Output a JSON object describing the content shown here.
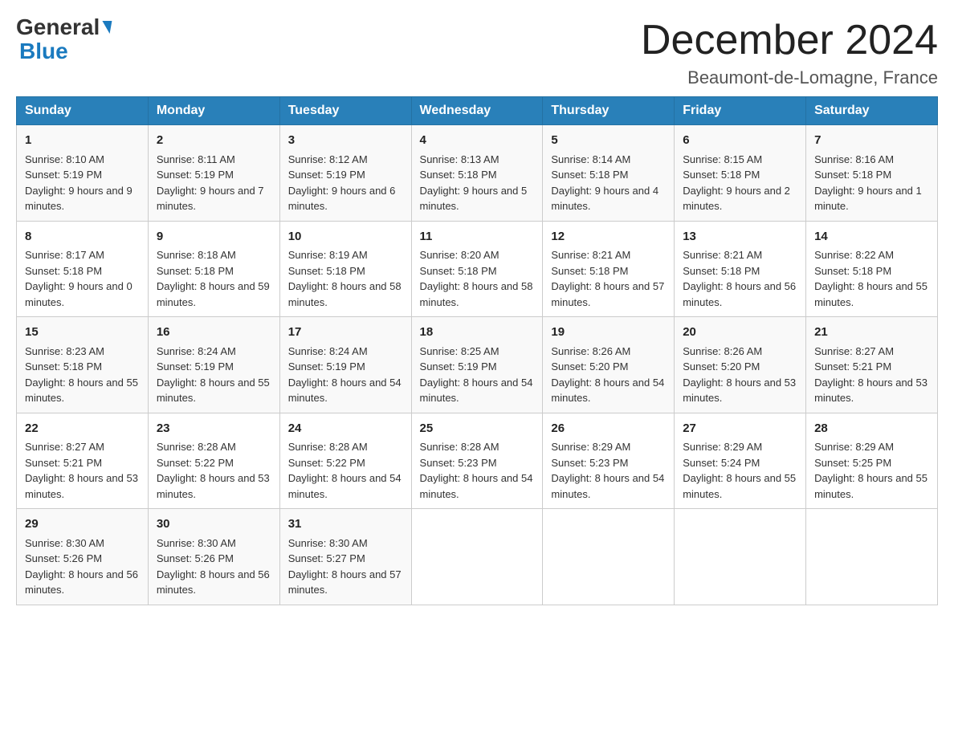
{
  "header": {
    "logo_line1": "General",
    "logo_line2": "Blue",
    "month_title": "December 2024",
    "location": "Beaumont-de-Lomagne, France"
  },
  "days_of_week": [
    "Sunday",
    "Monday",
    "Tuesday",
    "Wednesday",
    "Thursday",
    "Friday",
    "Saturday"
  ],
  "weeks": [
    [
      {
        "day": "1",
        "sunrise": "Sunrise: 8:10 AM",
        "sunset": "Sunset: 5:19 PM",
        "daylight": "Daylight: 9 hours and 9 minutes."
      },
      {
        "day": "2",
        "sunrise": "Sunrise: 8:11 AM",
        "sunset": "Sunset: 5:19 PM",
        "daylight": "Daylight: 9 hours and 7 minutes."
      },
      {
        "day": "3",
        "sunrise": "Sunrise: 8:12 AM",
        "sunset": "Sunset: 5:19 PM",
        "daylight": "Daylight: 9 hours and 6 minutes."
      },
      {
        "day": "4",
        "sunrise": "Sunrise: 8:13 AM",
        "sunset": "Sunset: 5:18 PM",
        "daylight": "Daylight: 9 hours and 5 minutes."
      },
      {
        "day": "5",
        "sunrise": "Sunrise: 8:14 AM",
        "sunset": "Sunset: 5:18 PM",
        "daylight": "Daylight: 9 hours and 4 minutes."
      },
      {
        "day": "6",
        "sunrise": "Sunrise: 8:15 AM",
        "sunset": "Sunset: 5:18 PM",
        "daylight": "Daylight: 9 hours and 2 minutes."
      },
      {
        "day": "7",
        "sunrise": "Sunrise: 8:16 AM",
        "sunset": "Sunset: 5:18 PM",
        "daylight": "Daylight: 9 hours and 1 minute."
      }
    ],
    [
      {
        "day": "8",
        "sunrise": "Sunrise: 8:17 AM",
        "sunset": "Sunset: 5:18 PM",
        "daylight": "Daylight: 9 hours and 0 minutes."
      },
      {
        "day": "9",
        "sunrise": "Sunrise: 8:18 AM",
        "sunset": "Sunset: 5:18 PM",
        "daylight": "Daylight: 8 hours and 59 minutes."
      },
      {
        "day": "10",
        "sunrise": "Sunrise: 8:19 AM",
        "sunset": "Sunset: 5:18 PM",
        "daylight": "Daylight: 8 hours and 58 minutes."
      },
      {
        "day": "11",
        "sunrise": "Sunrise: 8:20 AM",
        "sunset": "Sunset: 5:18 PM",
        "daylight": "Daylight: 8 hours and 58 minutes."
      },
      {
        "day": "12",
        "sunrise": "Sunrise: 8:21 AM",
        "sunset": "Sunset: 5:18 PM",
        "daylight": "Daylight: 8 hours and 57 minutes."
      },
      {
        "day": "13",
        "sunrise": "Sunrise: 8:21 AM",
        "sunset": "Sunset: 5:18 PM",
        "daylight": "Daylight: 8 hours and 56 minutes."
      },
      {
        "day": "14",
        "sunrise": "Sunrise: 8:22 AM",
        "sunset": "Sunset: 5:18 PM",
        "daylight": "Daylight: 8 hours and 55 minutes."
      }
    ],
    [
      {
        "day": "15",
        "sunrise": "Sunrise: 8:23 AM",
        "sunset": "Sunset: 5:18 PM",
        "daylight": "Daylight: 8 hours and 55 minutes."
      },
      {
        "day": "16",
        "sunrise": "Sunrise: 8:24 AM",
        "sunset": "Sunset: 5:19 PM",
        "daylight": "Daylight: 8 hours and 55 minutes."
      },
      {
        "day": "17",
        "sunrise": "Sunrise: 8:24 AM",
        "sunset": "Sunset: 5:19 PM",
        "daylight": "Daylight: 8 hours and 54 minutes."
      },
      {
        "day": "18",
        "sunrise": "Sunrise: 8:25 AM",
        "sunset": "Sunset: 5:19 PM",
        "daylight": "Daylight: 8 hours and 54 minutes."
      },
      {
        "day": "19",
        "sunrise": "Sunrise: 8:26 AM",
        "sunset": "Sunset: 5:20 PM",
        "daylight": "Daylight: 8 hours and 54 minutes."
      },
      {
        "day": "20",
        "sunrise": "Sunrise: 8:26 AM",
        "sunset": "Sunset: 5:20 PM",
        "daylight": "Daylight: 8 hours and 53 minutes."
      },
      {
        "day": "21",
        "sunrise": "Sunrise: 8:27 AM",
        "sunset": "Sunset: 5:21 PM",
        "daylight": "Daylight: 8 hours and 53 minutes."
      }
    ],
    [
      {
        "day": "22",
        "sunrise": "Sunrise: 8:27 AM",
        "sunset": "Sunset: 5:21 PM",
        "daylight": "Daylight: 8 hours and 53 minutes."
      },
      {
        "day": "23",
        "sunrise": "Sunrise: 8:28 AM",
        "sunset": "Sunset: 5:22 PM",
        "daylight": "Daylight: 8 hours and 53 minutes."
      },
      {
        "day": "24",
        "sunrise": "Sunrise: 8:28 AM",
        "sunset": "Sunset: 5:22 PM",
        "daylight": "Daylight: 8 hours and 54 minutes."
      },
      {
        "day": "25",
        "sunrise": "Sunrise: 8:28 AM",
        "sunset": "Sunset: 5:23 PM",
        "daylight": "Daylight: 8 hours and 54 minutes."
      },
      {
        "day": "26",
        "sunrise": "Sunrise: 8:29 AM",
        "sunset": "Sunset: 5:23 PM",
        "daylight": "Daylight: 8 hours and 54 minutes."
      },
      {
        "day": "27",
        "sunrise": "Sunrise: 8:29 AM",
        "sunset": "Sunset: 5:24 PM",
        "daylight": "Daylight: 8 hours and 55 minutes."
      },
      {
        "day": "28",
        "sunrise": "Sunrise: 8:29 AM",
        "sunset": "Sunset: 5:25 PM",
        "daylight": "Daylight: 8 hours and 55 minutes."
      }
    ],
    [
      {
        "day": "29",
        "sunrise": "Sunrise: 8:30 AM",
        "sunset": "Sunset: 5:26 PM",
        "daylight": "Daylight: 8 hours and 56 minutes."
      },
      {
        "day": "30",
        "sunrise": "Sunrise: 8:30 AM",
        "sunset": "Sunset: 5:26 PM",
        "daylight": "Daylight: 8 hours and 56 minutes."
      },
      {
        "day": "31",
        "sunrise": "Sunrise: 8:30 AM",
        "sunset": "Sunset: 5:27 PM",
        "daylight": "Daylight: 8 hours and 57 minutes."
      },
      null,
      null,
      null,
      null
    ]
  ]
}
